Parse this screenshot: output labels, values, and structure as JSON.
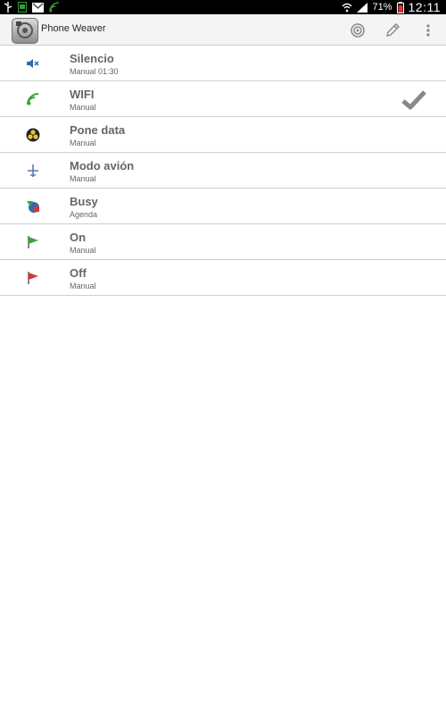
{
  "statusbar": {
    "battery_percent": "71%",
    "time": "12:11"
  },
  "actionbar": {
    "title": "Phone Weaver"
  },
  "profiles": [
    {
      "name": "Silencio",
      "mode": "Manual  01:30",
      "icon": "muted-speaker-icon",
      "active": false
    },
    {
      "name": "WIFI",
      "mode": "Manual",
      "icon": "wifi-signal-icon",
      "active": true
    },
    {
      "name": "Pone data",
      "mode": "Manual",
      "icon": "mobile-data-icon",
      "active": false
    },
    {
      "name": "Modo avión",
      "mode": "Manual",
      "icon": "airplane-icon",
      "active": false
    },
    {
      "name": "Busy",
      "mode": "Agenda",
      "icon": "calendar-agenda-icon",
      "active": false
    },
    {
      "name": "On",
      "mode": "Manual",
      "icon": "green-flag-icon",
      "active": false
    },
    {
      "name": "Off",
      "mode": "Manual",
      "icon": "red-flag-icon",
      "active": false
    }
  ],
  "colors": {
    "title_text": "#666666",
    "divider": "#cfcfcf",
    "check": "#888888"
  }
}
